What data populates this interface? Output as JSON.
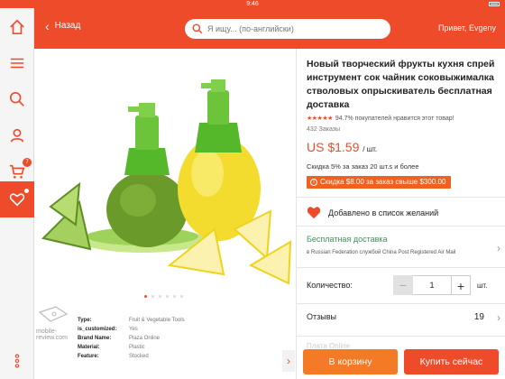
{
  "status": {
    "time": "9:46"
  },
  "header": {
    "back_label": "Назад",
    "search_placeholder": "Я ищу... (по-английски)",
    "greeting": "Привет, Evgeny"
  },
  "sidebar": {
    "items": [
      {
        "name": "home-icon"
      },
      {
        "name": "menu-icon"
      },
      {
        "name": "search-icon"
      },
      {
        "name": "account-icon"
      },
      {
        "name": "cart-icon",
        "badge": "7"
      },
      {
        "name": "heart-icon",
        "active": true
      },
      {
        "name": "more-icon"
      }
    ]
  },
  "product": {
    "title": "Новый творческий фрукты кухня спрей инструмент сок чайник соковыжималка стволовых опрыскиватель бесплатная доставка",
    "stars": "★★★★★",
    "rating_text": "94.7% покупателей нравится этот товар!",
    "orders": "432 Заказы",
    "price": "US $1.59",
    "price_unit": "/ шт.",
    "bulk_discount": "Скидка 5% за заказ 20 шт.s и более",
    "coupon": "Скидка $8.00 за заказ свыше $300.00",
    "wishlist_label": "Добавлено в список желаний",
    "shipping_title": "Бесплатная доставка",
    "shipping_via": "в Russian Federation службой China Post Registered Air Mail",
    "quantity_label": "Количество:",
    "quantity_value": "1",
    "quantity_unit": "шт.",
    "reviews_label": "Отзывы",
    "reviews_count": "19",
    "more_label": "Плата Online",
    "add_to_cart": "В корзину",
    "buy_now": "Купить сейчас"
  },
  "specs": [
    {
      "key": "Type:",
      "value": "Fruit & Vegetable Tools"
    },
    {
      "key": "is_customized:",
      "value": "Yes"
    },
    {
      "key": "Brand Name:",
      "value": "Plaza Online"
    },
    {
      "key": "Material:",
      "value": "Plastic"
    },
    {
      "key": "Feature:",
      "value": "Stocked"
    }
  ],
  "watermark": "mobile-review.com",
  "colors": {
    "accent": "#ee4b2b",
    "cart_button": "#f47a26",
    "free_shipping": "#2aa04a"
  }
}
